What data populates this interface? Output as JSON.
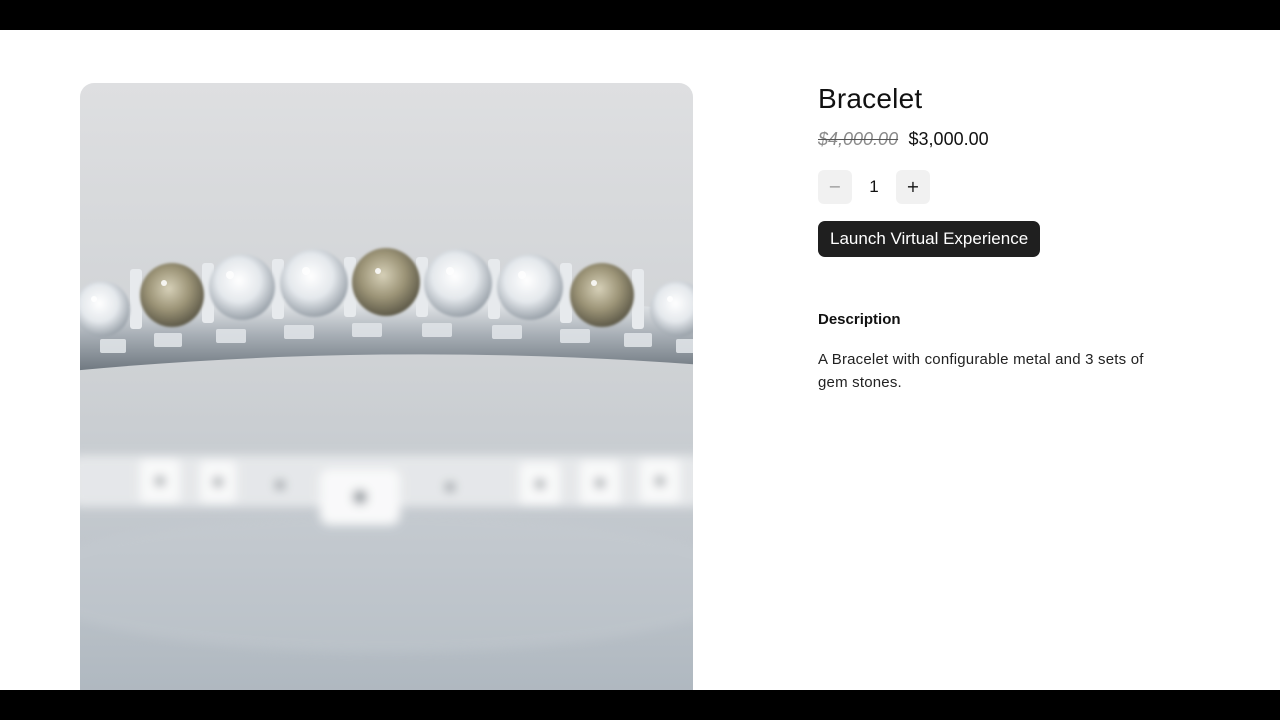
{
  "product": {
    "title": "Bracelet",
    "price_original": "$4,000.00",
    "price_sale": "$3,000.00",
    "quantity": "1",
    "quantity_decrease_symbol": "−",
    "quantity_increase_symbol": "+",
    "launch_button_label": "Launch Virtual Experience",
    "description_heading": "Description",
    "description_text": "A Bracelet with configurable metal and 3 sets of gem stones."
  },
  "image": {
    "subject": "bracelet-photo",
    "colors": {
      "background_top": "#dedfe1",
      "background_bottom": "#aeb7bf",
      "metal": "#c9ced3",
      "gem_clear": "#f2f4f6",
      "gem_champagne": "#9c9477"
    }
  },
  "theme": {
    "accent_button_bg": "#1f1f1f",
    "accent_button_text": "#ffffff",
    "qty_button_bg": "#f1f1f1"
  }
}
